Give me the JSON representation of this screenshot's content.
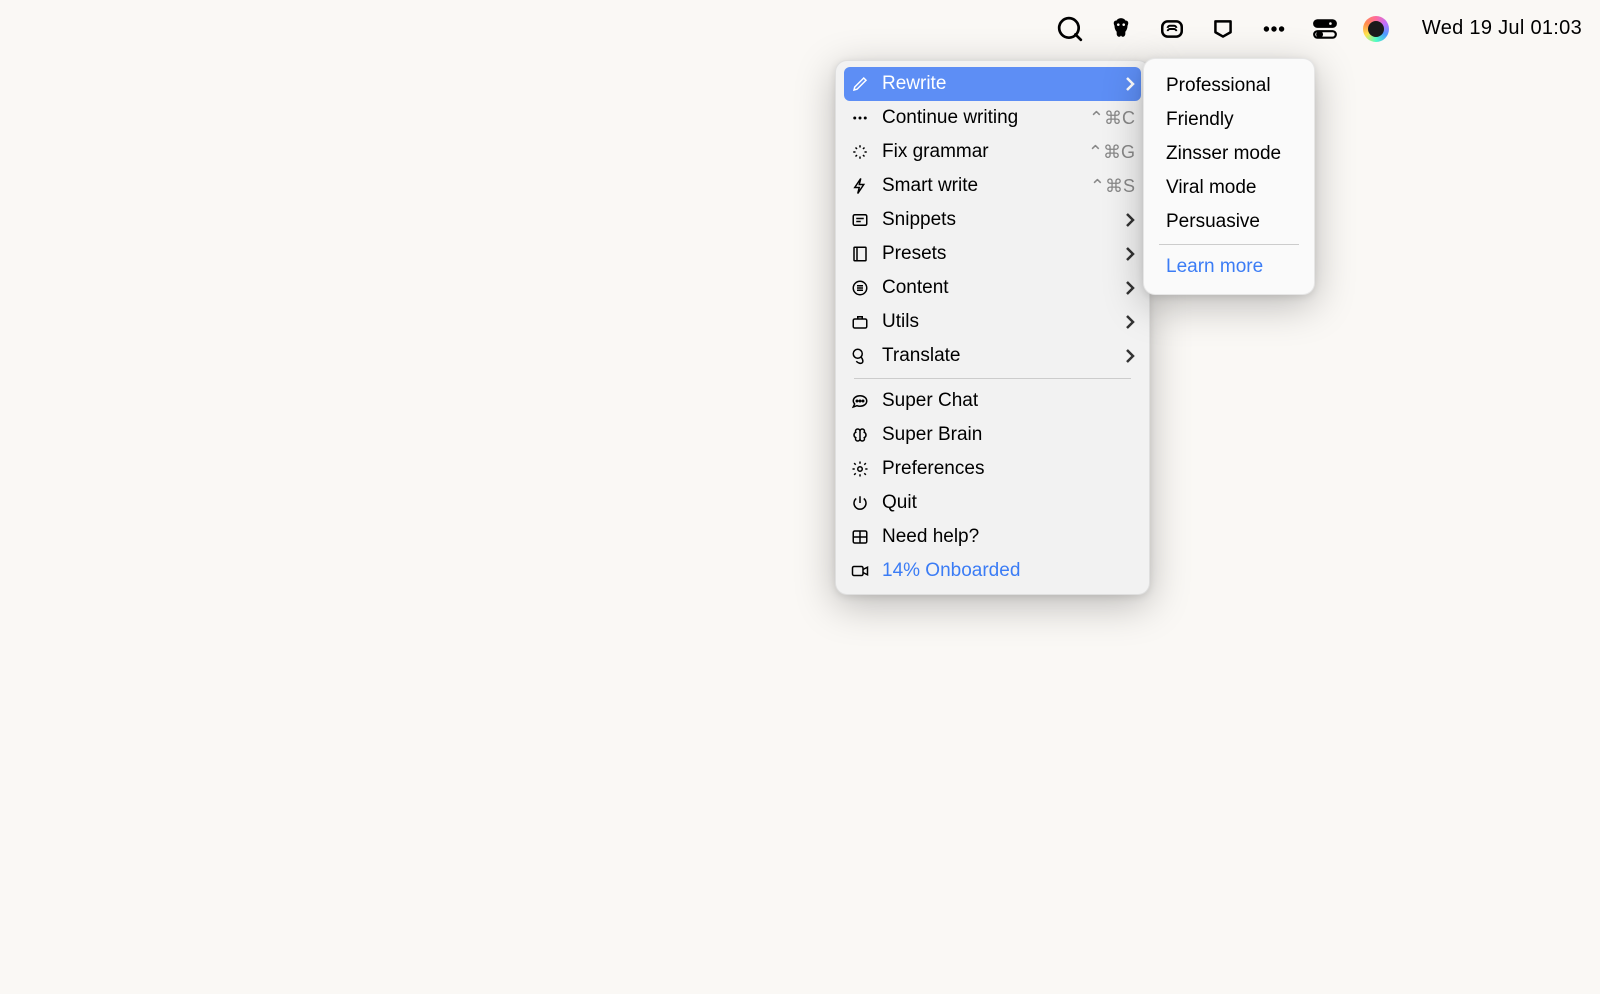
{
  "menubar": {
    "datetime": "Wed 19 Jul  01:03"
  },
  "menu": {
    "items": [
      {
        "label": "Rewrite",
        "hasSubmenu": true,
        "highlighted": true
      },
      {
        "label": "Continue writing",
        "shortcut": "⌃⌘C"
      },
      {
        "label": "Fix grammar",
        "shortcut": "⌃⌘G"
      },
      {
        "label": "Smart write",
        "shortcut": "⌃⌘S"
      },
      {
        "label": "Snippets",
        "hasSubmenu": true
      },
      {
        "label": "Presets",
        "hasSubmenu": true
      },
      {
        "label": "Content",
        "hasSubmenu": true
      },
      {
        "label": "Utils",
        "hasSubmenu": true
      },
      {
        "label": "Translate",
        "hasSubmenu": true
      }
    ],
    "items2": [
      {
        "label": "Super Chat"
      },
      {
        "label": "Super Brain"
      },
      {
        "label": "Preferences"
      },
      {
        "label": "Quit"
      },
      {
        "label": "Need help?"
      },
      {
        "label": "14% Onboarded",
        "link": true
      }
    ]
  },
  "submenu": {
    "items": [
      {
        "label": "Professional"
      },
      {
        "label": "Friendly"
      },
      {
        "label": "Zinsser mode"
      },
      {
        "label": "Viral mode"
      },
      {
        "label": "Persuasive"
      }
    ],
    "learnMore": "Learn more"
  }
}
